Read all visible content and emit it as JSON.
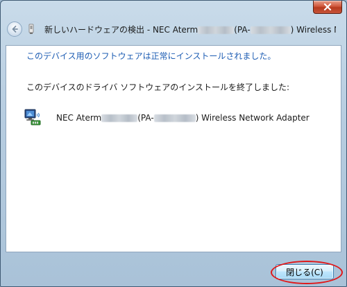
{
  "window": {
    "title_prefix": "新しいハードウェアの検出 - NEC Aterm",
    "title_mid": "(PA-",
    "title_suffix": ") Wireless Netw"
  },
  "content": {
    "success_message": "このデバイス用のソフトウェアは正常にインストールされました。",
    "finished_message": "このデバイスのドライバ ソフトウェアのインストールを終了しました:",
    "device": {
      "name_prefix": "NEC Aterm",
      "name_mid": "(PA-",
      "name_suffix": ") Wireless Network Adapter",
      "icon": "network-adapter-icon"
    }
  },
  "footer": {
    "close_label": "閉じる(C)"
  },
  "icons": {
    "window_close": "close-icon",
    "back": "back-arrow-icon",
    "title_device": "device-icon"
  },
  "colors": {
    "success_text": "#1c5cb3",
    "highlight_ring": "#e0181a",
    "window_close": "#c8553a"
  }
}
